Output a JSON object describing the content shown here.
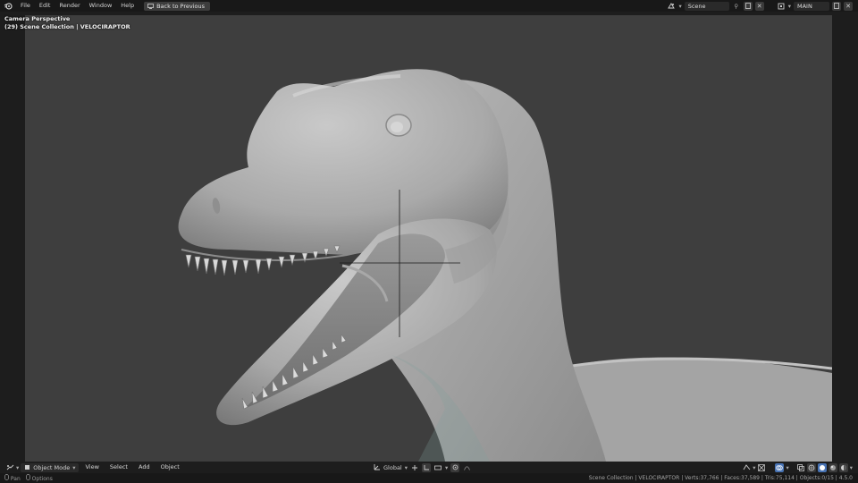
{
  "menu": {
    "items": [
      "File",
      "Edit",
      "Render",
      "Window",
      "Help"
    ],
    "back_label": "Back to Previous"
  },
  "workspace": {
    "scene_name": "Scene",
    "view_layer": "MAIN"
  },
  "viewport": {
    "camera_label": "Camera Perspective",
    "collection_label": "(29) Scene Collection | VELOCIRAPTOR"
  },
  "header": {
    "mode": "Object Mode",
    "menus": [
      "View",
      "Select",
      "Add",
      "Object"
    ],
    "transform_orientation": "Global"
  },
  "status": {
    "left": [
      "Pan",
      "Options"
    ],
    "right": "Scene Collection | VELOCIRAPTOR | Verts:37,766 | Faces:37,589 | Tris:75,114 | Objects:0/15 | 4.5.0"
  },
  "colors": {
    "viewport_bg": "#3e3e3e",
    "topbar_bg": "#181818",
    "accent": "#4772b3"
  }
}
